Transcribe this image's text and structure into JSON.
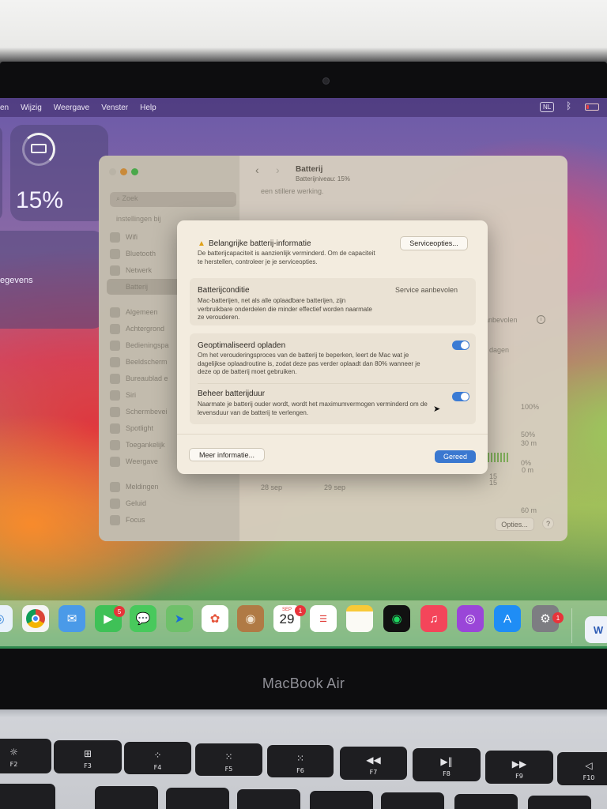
{
  "menubar": {
    "items": [
      "en",
      "Wijzig",
      "Weergave",
      "Venster",
      "Help"
    ],
    "input_source": "NL"
  },
  "widgets": {
    "battery_percent": "15%",
    "partial_label": "egevens"
  },
  "window": {
    "title": "Batterij",
    "subtitle": "Batterijniveau: 15%",
    "search_placeholder": "Zoek",
    "sidebar_hint": "instellingen bij",
    "sidebar_items": [
      "Wifi",
      "Bluetooth",
      "Netwerk",
      "Batterij",
      "Algemeen",
      "Achtergrond",
      "Bedieningspa",
      "Beeldscherm",
      "Bureaublad e",
      "Siri",
      "Schermbevei",
      "Spotlight",
      "Toegankelijk",
      "Weergave",
      "Meldingen",
      "Geluid",
      "Focus"
    ],
    "bg_fragments": {
      "stiller": "een stillere werking.",
      "aanbevolen": "anbevolen",
      "dagen": "dagen",
      "p100": "100%",
      "p50": "50%",
      "p0": "0%",
      "tick15a": "15",
      "m60": "60 m",
      "m30": "30 m",
      "m0": "0 m",
      "tick15b": "15",
      "date1": "28 sep",
      "date2": "29 sep"
    },
    "options_button": "Opties...",
    "help_button": "?"
  },
  "modal": {
    "header_title": "Belangrijke batterij-informatie",
    "header_text": "De batterijcapaciteit is aanzienlijk verminderd. Om de capaciteit te herstellen, controleer je je serviceopties.",
    "service_button": "Serviceopties...",
    "condition_title": "Batterijconditie",
    "condition_value": "Service aanbevolen",
    "condition_text": "Mac-batterijen, net als alle oplaadbare batterijen, zijn verbruikbare onderdelen die minder effectief worden naarmate ze verouderen.",
    "opt_title": "Geoptimaliseerd opladen",
    "opt_text": "Om het verouderingsproces van de batterij te beperken, leert de Mac wat je dagelijkse oplaadroutine is, zodat deze pas verder oplaadt dan 80% wanneer je deze op de batterij moet gebruiken.",
    "opt_enabled": true,
    "manage_title": "Beheer batterijduur",
    "manage_text": "Naarmate je batterij ouder wordt, wordt het maximumvermogen verminderd om de levensduur van de batterij te verlengen.",
    "manage_enabled": true,
    "more_info_button": "Meer informatie...",
    "done_button": "Gereed"
  },
  "dock": {
    "facetime_badge": "5",
    "calendar_month": "SEP",
    "calendar_day": "29",
    "calendar_badge": "1",
    "settings_badge": "1",
    "icons": [
      "safari-icon",
      "chrome-icon",
      "mail-icon",
      "facetime-icon",
      "messages-icon",
      "maps-icon",
      "photos-icon",
      "contacts-icon",
      "calendar-icon",
      "reminders-icon",
      "notes-icon",
      "spotify-icon",
      "music-icon",
      "podcasts-icon",
      "app-store-icon",
      "system-settings-icon",
      "word-icon"
    ]
  },
  "device": {
    "brand": "MacBook Air"
  },
  "keyboard": [
    {
      "icon": "☼",
      "label": "F2"
    },
    {
      "icon": "⊞",
      "label": "F3"
    },
    {
      "icon": "⁘",
      "label": "F4"
    },
    {
      "icon": "⁙",
      "label": "F5"
    },
    {
      "icon": "⁙",
      "label": "F6"
    },
    {
      "icon": "◀◀",
      "label": "F7"
    },
    {
      "icon": "▶‖",
      "label": "F8"
    },
    {
      "icon": "▶▶",
      "label": "F9"
    },
    {
      "icon": "◁",
      "label": "F10"
    }
  ]
}
